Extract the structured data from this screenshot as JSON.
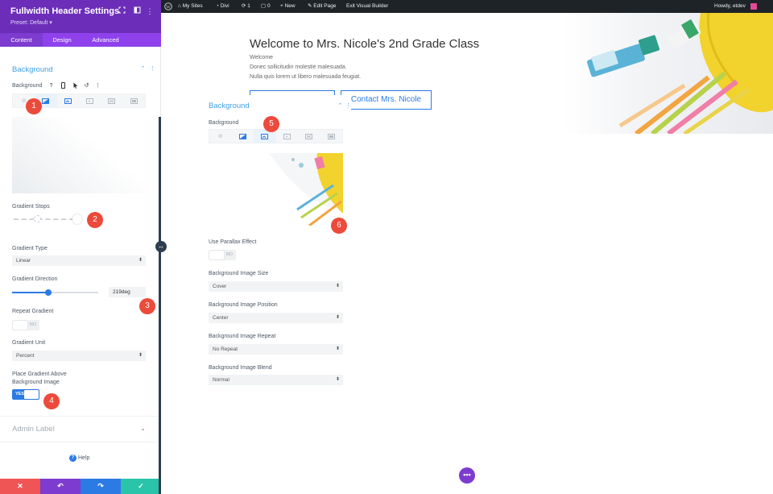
{
  "panel": {
    "title": "Fullwidth Header Settings",
    "preset": "Preset: Default ▾",
    "tabs": [
      "Content",
      "Design",
      "Advanced"
    ],
    "section_title": "Background",
    "background_label": "Background",
    "gradient_stops_label": "Gradient Stops",
    "gradient_type_label": "Gradient Type",
    "gradient_type_value": "Linear",
    "gradient_direction_label": "Gradient Direction",
    "gradient_direction_value": "219deg",
    "gradient_direction_level": 0.42,
    "repeat_gradient_label": "Repeat Gradient",
    "repeat_gradient_value": "NO",
    "gradient_unit_label": "Gradient Unit",
    "gradient_unit_value": "Percent",
    "place_above_label_1": "Place Gradient Above",
    "place_above_label_2": "Background Image",
    "place_above_value": "YES",
    "admin_label": "Admin Label",
    "help": "Help"
  },
  "markers": [
    "1",
    "2",
    "3",
    "4",
    "5",
    "6"
  ],
  "adminbar": {
    "my_sites": "My Sites",
    "divi": "Divi",
    "updates": "1",
    "comments": "0",
    "new": "+ New",
    "edit_page": "Edit Page",
    "exit_vb": "Exit Visual Builder",
    "howdy": "Howdy, etdev"
  },
  "hero": {
    "title": "Welcome to Mrs. Nicole's 2nd Grade Class",
    "line1": "Welcome",
    "line2": "Donec sollicitudin molestie malesuada.",
    "line3": "Nulla quis lorem ut libero malesuada feugiat.",
    "button2": "Contact Mrs. Nicole"
  },
  "card": {
    "section_title": "Background",
    "background_label": "Background",
    "parallax_label": "Use Parallax Effect",
    "parallax_value": "NO",
    "size_label": "Background Image Size",
    "size_value": "Cover",
    "position_label": "Background Image Position",
    "position_value": "Center",
    "repeat_label": "Background Image Repeat",
    "repeat_value": "No Repeat",
    "blend_label": "Background Image Blend",
    "blend_value": "Normal"
  },
  "colors": {
    "purple_dark": "#6c2eb9",
    "purple": "#8f42ec",
    "blue": "#2c7be5",
    "red": "#ec4a3b",
    "green": "#29c4a9"
  }
}
